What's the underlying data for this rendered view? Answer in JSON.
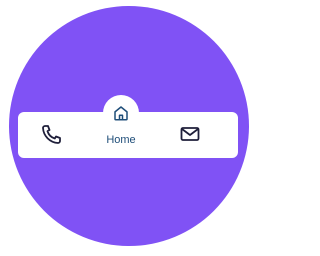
{
  "colors": {
    "background_circle": "#8052f5",
    "nav_background": "#ffffff",
    "icon_color": "#1f1f3a",
    "active_color": "#1f4e79"
  },
  "nav": {
    "items": [
      {
        "icon": "phone-icon",
        "label": ""
      },
      {
        "icon": "home-icon",
        "label": "Home",
        "active": true
      },
      {
        "icon": "mail-icon",
        "label": ""
      }
    ]
  }
}
